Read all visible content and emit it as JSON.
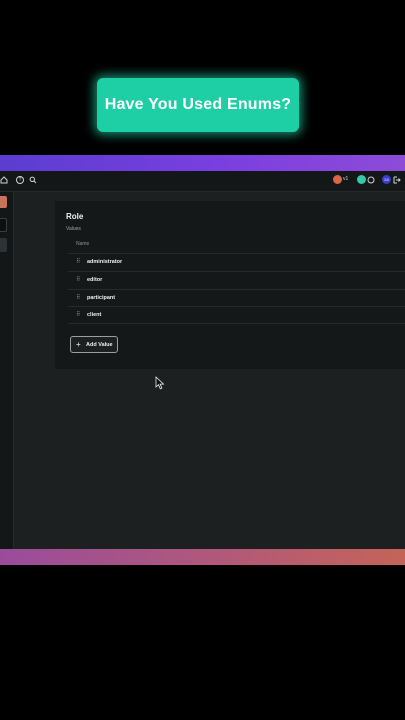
{
  "caption": {
    "text": "Have You Used Enums?"
  },
  "toolbar": {
    "icons": [
      "home-icon",
      "help-icon",
      "search-icon",
      "chat-icon",
      "exit-icon"
    ],
    "version_label": "v1",
    "avatar_initials": "24"
  },
  "enum": {
    "title": "Role",
    "subtitle": "Values",
    "column_header": "Name",
    "values": [
      "administrator",
      "editor",
      "participant",
      "client"
    ],
    "add_button_label": "Add Value"
  },
  "colors": {
    "caption_accent": "#1ecfa5",
    "top_gradient": "#6a3fd8",
    "bottom_gradient": "#b45a76",
    "panel_bg": "#151819"
  }
}
